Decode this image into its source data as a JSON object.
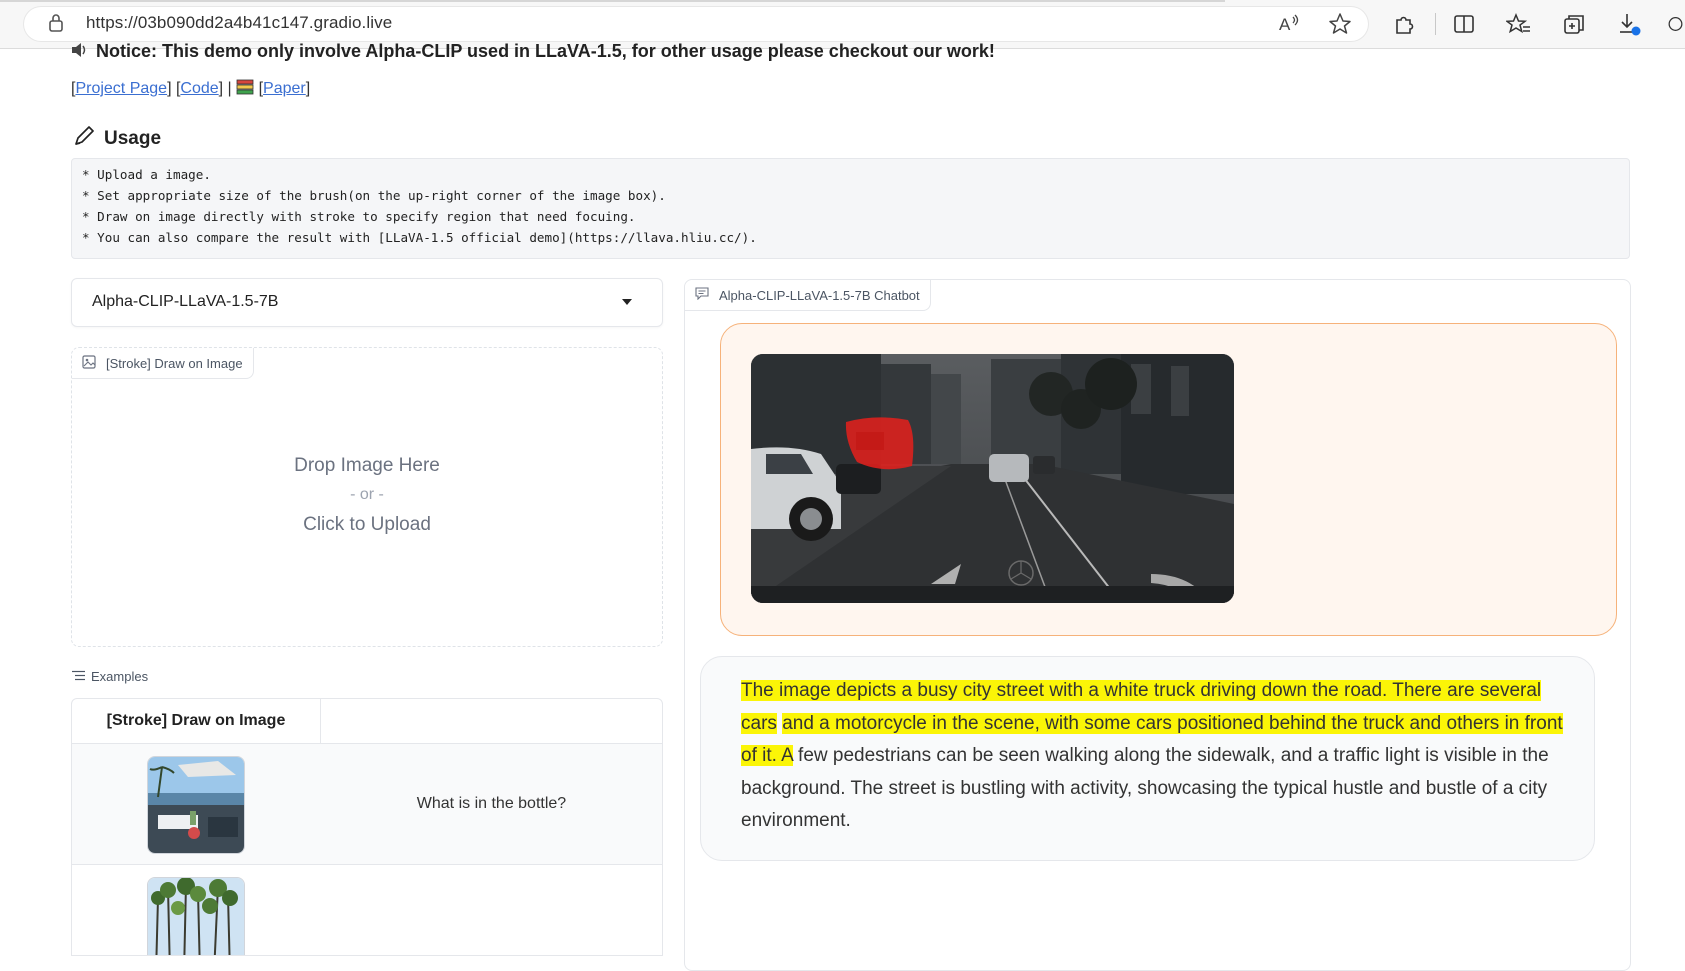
{
  "browser": {
    "url": "https://03b090dd2a4b41c147.gradio.live"
  },
  "notice": "Notice: This demo only involve Alpha-CLIP used in LLaVA-1.5, for other usage please checkout our work!",
  "links": {
    "project_page": "Project Page",
    "code": "Code",
    "paper": "Paper",
    "separator": "|"
  },
  "usage": {
    "title": "Usage",
    "lines": [
      "* Upload a image.",
      "* Set appropriate size of the brush(on the up-right corner of the image box).",
      "* Draw on image directly with stroke to specify region that need focuing.",
      "* You can also compare the result with [LLaVA-1.5 official demo](https://llava.hliu.cc/)."
    ]
  },
  "model_select": {
    "value": "Alpha-CLIP-LLaVA-1.5-7B"
  },
  "image_input": {
    "label": "[Stroke] Draw on Image",
    "drop_text": "Drop Image Here",
    "or_text": "- or -",
    "click_text": "Click to Upload"
  },
  "examples": {
    "label": "Examples",
    "headers": [
      "[Stroke] Draw on Image",
      ""
    ],
    "rows": [
      {
        "question": "What is in the bottle?"
      },
      {
        "question": ""
      }
    ]
  },
  "chatbot": {
    "label": "Alpha-CLIP-LLaVA-1.5-7B Chatbot",
    "response_highlighted_1": "The image depicts a busy city street with a white truck driving down the road. There are several cars",
    "response_highlighted_2": "and a motorcycle in the scene, with some cars positioned behind the truck and others in front of it. A",
    "response_rest": "few pedestrians can be seen walking along the sidewalk, and a traffic light is visible in the background. The street is bustling with activity, showcasing the typical hustle and bustle of a city environment."
  },
  "colors": {
    "link": "#3b6fd1",
    "highlight": "#fbf507",
    "user_bubble_bg": "#fff6ef",
    "user_bubble_border": "#f6b27a",
    "stroke_mark": "#e0201c"
  }
}
